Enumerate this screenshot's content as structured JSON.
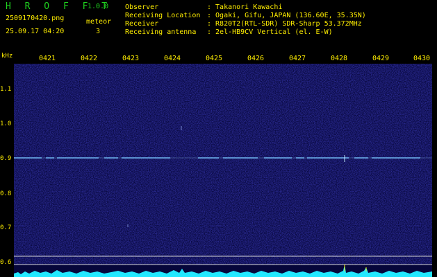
{
  "header": {
    "app_name": "H R O F F T",
    "version": "1.0.0",
    "filename": "2509170420.png",
    "datetime": "25.09.17 04:20",
    "meteor_label": "meteor",
    "meteor_count": "3",
    "fields": [
      {
        "label": "Observer",
        "value": ": Takanori Kawachi"
      },
      {
        "label": "Receiving Location",
        "value": ": Ogaki, Gifu, JAPAN (136.60E, 35.35N)"
      },
      {
        "label": "Receiver",
        "value": ": R820T2(RTL-SDR) SDR-Sharp 53.372MHz"
      },
      {
        "label": "Receiving antenna",
        "value": ": 2el-HB9CV Vertical (el. E-W)"
      }
    ]
  },
  "axis": {
    "unit": "kHz",
    "time_labels": [
      "0421",
      "0422",
      "0423",
      "0424",
      "0425",
      "0426",
      "0427",
      "0428",
      "0429",
      "0430"
    ],
    "freq_labels": [
      "1.1",
      "1.0",
      "0.9",
      "0.8",
      "0.7",
      "0.6"
    ],
    "freq_values": [
      1.1,
      1.0,
      0.9,
      0.8,
      0.7,
      0.6
    ]
  },
  "colors": {
    "background": "#000000",
    "spectrogram": "#0a0a5a",
    "carrier": "#6fc2ff",
    "text": "#ffee00",
    "title": "#1fd21f",
    "baseline": "#22e8ff"
  }
}
